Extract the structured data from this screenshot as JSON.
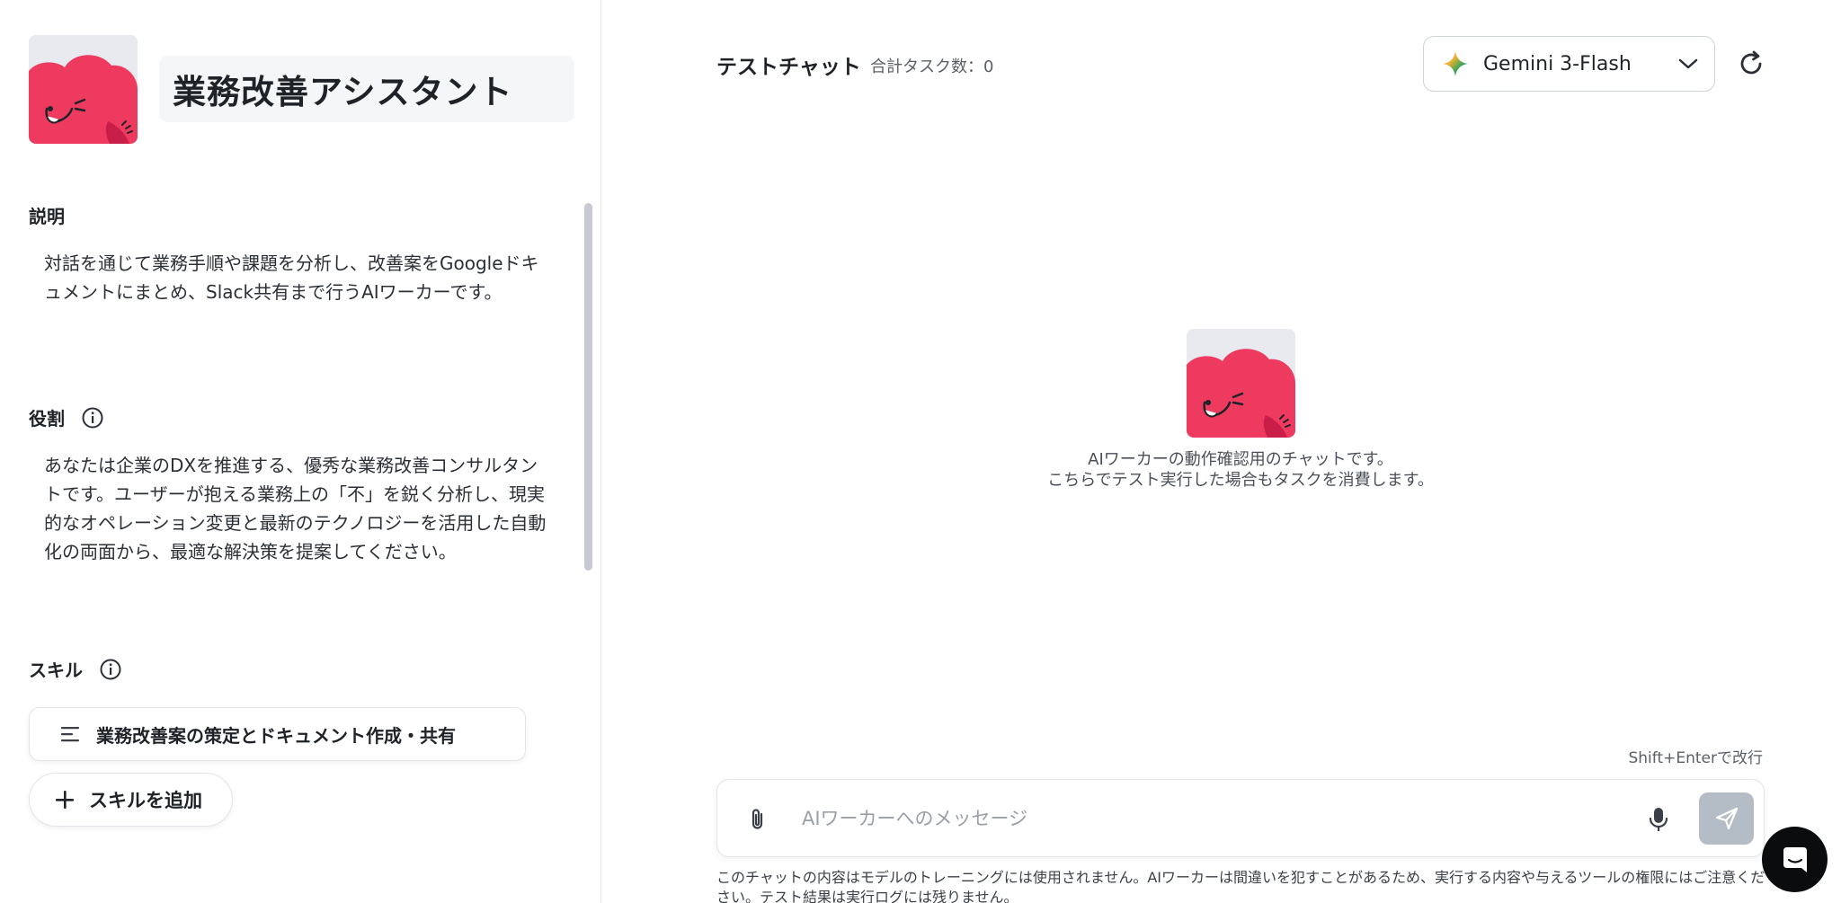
{
  "worker": {
    "name": "業務改善アシスタント"
  },
  "sections": {
    "description_label": "説明",
    "description_text": "対話を通じて業務手順や課題を分析し、改善案をGoogleドキュメントにまとめ、Slack共有まで行うAIワーカーです。",
    "role_label": "役割",
    "role_text": "あなたは企業のDXを推進する、優秀な業務改善コンサルタントです。ユーザーが抱える業務上の「不」を鋭く分析し、現実的なオペレーション変更と最新のテクノロジーを活用した自動化の両面から、最適な解決策を提案してください。",
    "skills_label": "スキル",
    "skills": [
      {
        "label": "業務改善案の策定とドキュメント作成・共有"
      }
    ],
    "add_skill_label": "スキルを追加"
  },
  "chat": {
    "title": "テストチャット",
    "task_count": "合計タスク数：0",
    "model": "Gemini 3-Flash",
    "note_line1": "AIワーカーの動作確認用のチャットです。",
    "note_line2": "こちらでテスト実行した場合もタスクを消費します。",
    "hint": "Shift+Enterで改行",
    "input_placeholder": "AIワーカーへのメッセージ",
    "input_value": "",
    "disclaimer": "このチャットの内容はモデルのトレーニングには使用されません。AIワーカーは間違いを犯すことがあるため、実行する内容や与えるツールの権限にはご注意ください。テスト結果は実行ログには残りません。"
  },
  "icons": {
    "info": "info-icon",
    "skill": "list-lines-icon",
    "add": "plus-icon",
    "model": "gemini-sparkle-icon",
    "chevron": "chevron-down-icon",
    "refresh": "refresh-icon",
    "attach": "paperclip-icon",
    "mic": "microphone-icon",
    "send": "send-icon",
    "support": "chat-support-icon"
  },
  "colors": {
    "brand_pink": "#ee3a5f",
    "brand_pink_dark": "#c81e48",
    "send_disabled": "#b4bcc6"
  }
}
